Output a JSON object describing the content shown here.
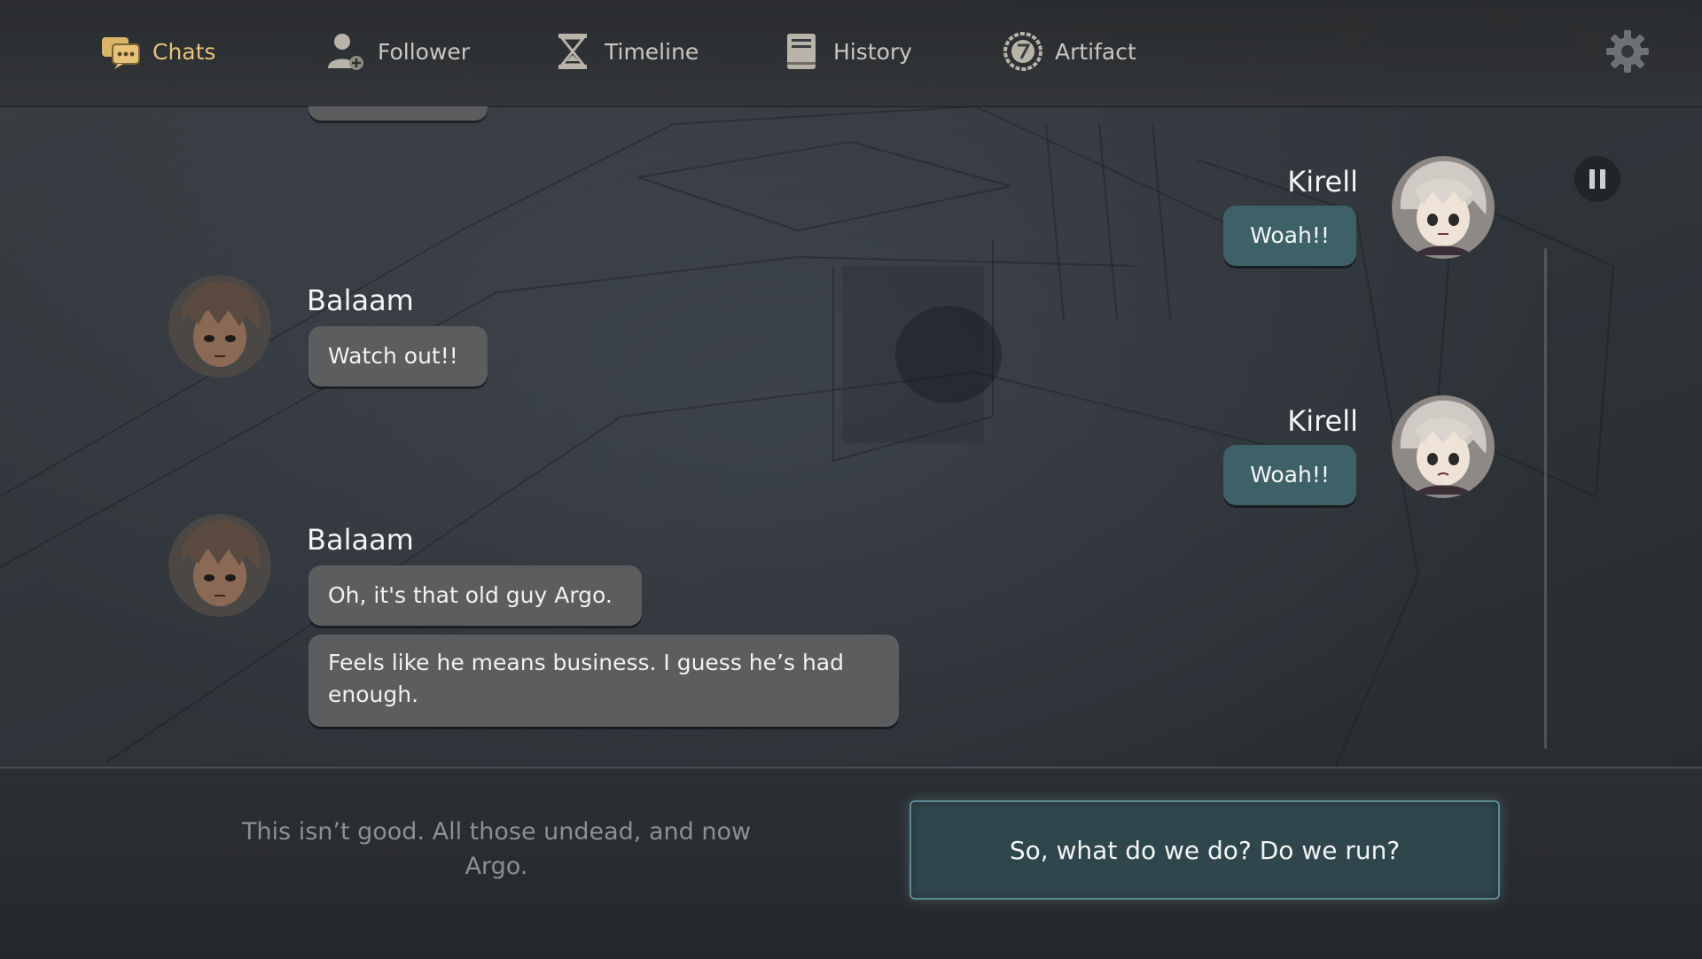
{
  "nav": {
    "items": [
      {
        "label": "Chats",
        "icon": "chat-bubbles-icon",
        "active": true
      },
      {
        "label": "Follower",
        "icon": "person-add-icon"
      },
      {
        "label": "Timeline",
        "icon": "hourglass-icon"
      },
      {
        "label": "History",
        "icon": "book-icon"
      },
      {
        "label": "Artifact",
        "icon": "seven-medallion-icon"
      }
    ],
    "settings_icon": "gear-icon"
  },
  "chat": {
    "messages": [
      {
        "speaker": "Kirell",
        "side": "right",
        "text": "Woah!!"
      },
      {
        "speaker": "Balaam",
        "side": "left",
        "text": "Watch out!!"
      },
      {
        "speaker": "Kirell",
        "side": "right",
        "text": "Woah!!"
      },
      {
        "speaker": "Balaam",
        "side": "left",
        "text": "Oh, it's that old guy Argo."
      },
      {
        "speaker": "Balaam",
        "side": "left",
        "text": "Feels like he means business. I guess he’s had enough."
      }
    ],
    "pause_icon": "pause-icon"
  },
  "choices": {
    "option_1": "This isn’t good. All those undead, and now Argo.",
    "option_2": "So, what do we do? Do we run?"
  },
  "colors": {
    "accent_active": "#e6c27a",
    "player_bubble": "#3e6168",
    "npc_bubble": "#5c5d5e",
    "choice_border": "#5d8c95"
  }
}
